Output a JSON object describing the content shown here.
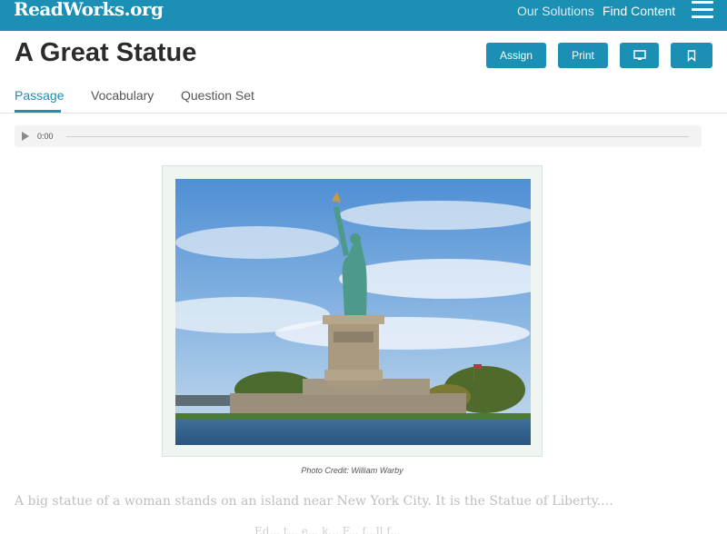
{
  "header": {
    "logo": "ReadWorks.org",
    "nav": {
      "solutions": "Our Solutions",
      "find_content": "Find Content"
    }
  },
  "article": {
    "title": "A Great Statue",
    "actions": {
      "assign": "Assign",
      "print": "Print"
    },
    "tabs": [
      "Passage",
      "Vocabulary",
      "Question Set"
    ],
    "audio_time": "0:00",
    "photo_credit": "Photo Credit: William Warby",
    "first_line": "A big statue of a woman stands on an island near New York City. It is the Statue of Liberty....",
    "next_line_partial": "Ed... t... e... k... F... f...ll f..."
  },
  "icons": {
    "menu": "hamburger-icon",
    "present": "monitor-icon",
    "bookmark": "bookmark-icon",
    "play": "play-icon"
  },
  "colors": {
    "brand": "#1b8fb4",
    "text": "#2b2b2b"
  }
}
